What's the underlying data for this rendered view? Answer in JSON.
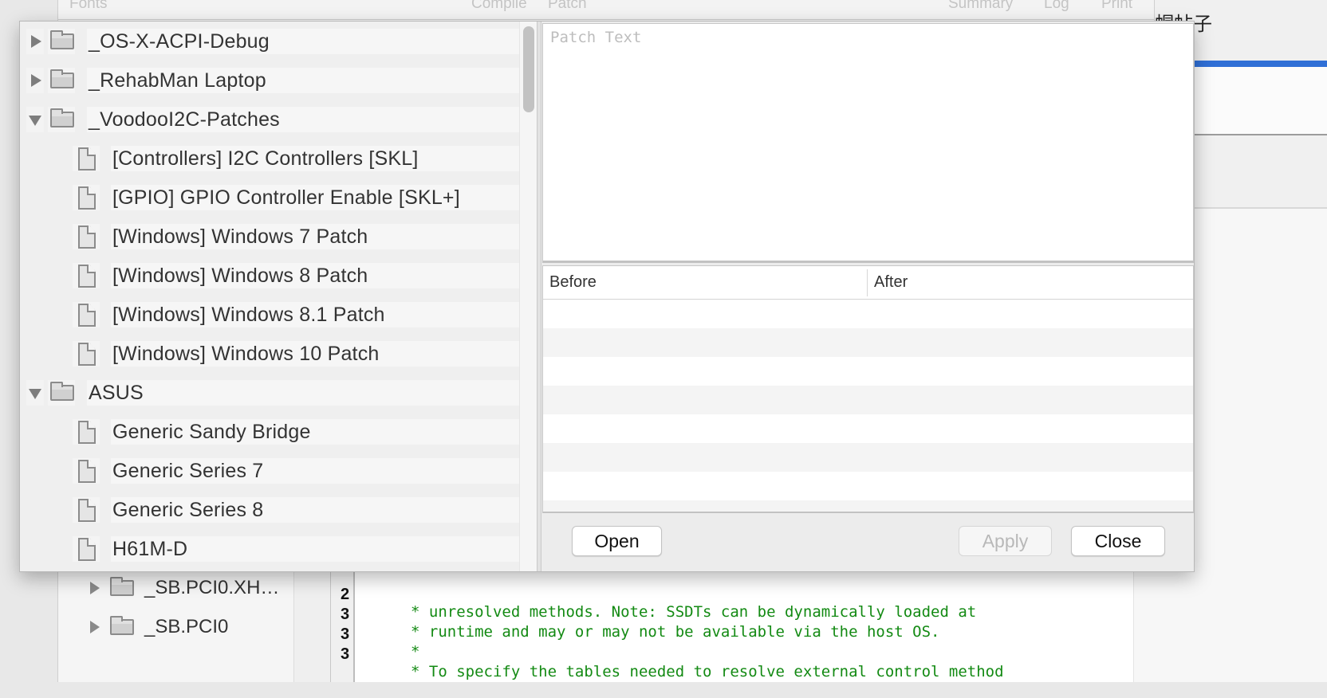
{
  "background_window": {
    "toolbar": {
      "items": [
        "Fonts",
        "Compile",
        "Patch",
        "Summary",
        "Log",
        "Print"
      ]
    },
    "tree": [
      {
        "label": "_SB.PCI0.XH…",
        "type": "folder",
        "expanded": false
      },
      {
        "label": "_SB.PCI0",
        "type": "folder",
        "expanded": false
      }
    ],
    "editor": {
      "lines": [
        {
          "number": "2",
          "text": "* unresolved methods. Note: SSDTs can be dynamically loaded at"
        },
        {
          "number": "3",
          "text": "* runtime and may or may not be available via the host OS."
        },
        {
          "number": "3",
          "text": "*"
        },
        {
          "number": "3",
          "text": "* To specify the tables needed to resolve external control method"
        }
      ]
    },
    "right_partial_text": "帽帖子",
    "accent_color": "#2f6fd6"
  },
  "dialog": {
    "tree": [
      {
        "label": "_OS-X-ACPI-Debug",
        "type": "folder",
        "expanded": false,
        "depth": 0
      },
      {
        "label": "_RehabMan Laptop",
        "type": "folder",
        "expanded": false,
        "depth": 0
      },
      {
        "label": "_VoodooI2C-Patches",
        "type": "folder",
        "expanded": true,
        "depth": 0
      },
      {
        "label": "[Controllers] I2C Controllers [SKL]",
        "type": "file",
        "depth": 1
      },
      {
        "label": "[GPIO] GPIO Controller Enable [SKL+]",
        "type": "file",
        "depth": 1
      },
      {
        "label": "[Windows] Windows 7 Patch",
        "type": "file",
        "depth": 1
      },
      {
        "label": "[Windows] Windows 8 Patch",
        "type": "file",
        "depth": 1
      },
      {
        "label": "[Windows] Windows 8.1 Patch",
        "type": "file",
        "depth": 1
      },
      {
        "label": "[Windows] Windows 10 Patch",
        "type": "file",
        "depth": 1
      },
      {
        "label": "ASUS",
        "type": "folder",
        "expanded": true,
        "depth": 0
      },
      {
        "label": "Generic Sandy Bridge",
        "type": "file",
        "depth": 1
      },
      {
        "label": "Generic Series 7",
        "type": "file",
        "depth": 1
      },
      {
        "label": "Generic Series 8",
        "type": "file",
        "depth": 1
      },
      {
        "label": "H61M-D",
        "type": "file",
        "depth": 1
      }
    ],
    "patch_text": {
      "value": "",
      "placeholder": "Patch Text"
    },
    "diff_table": {
      "columns": [
        "Before",
        "After"
      ],
      "rows": []
    },
    "buttons": {
      "open": "Open",
      "apply": "Apply",
      "apply_enabled": false,
      "close": "Close"
    }
  }
}
